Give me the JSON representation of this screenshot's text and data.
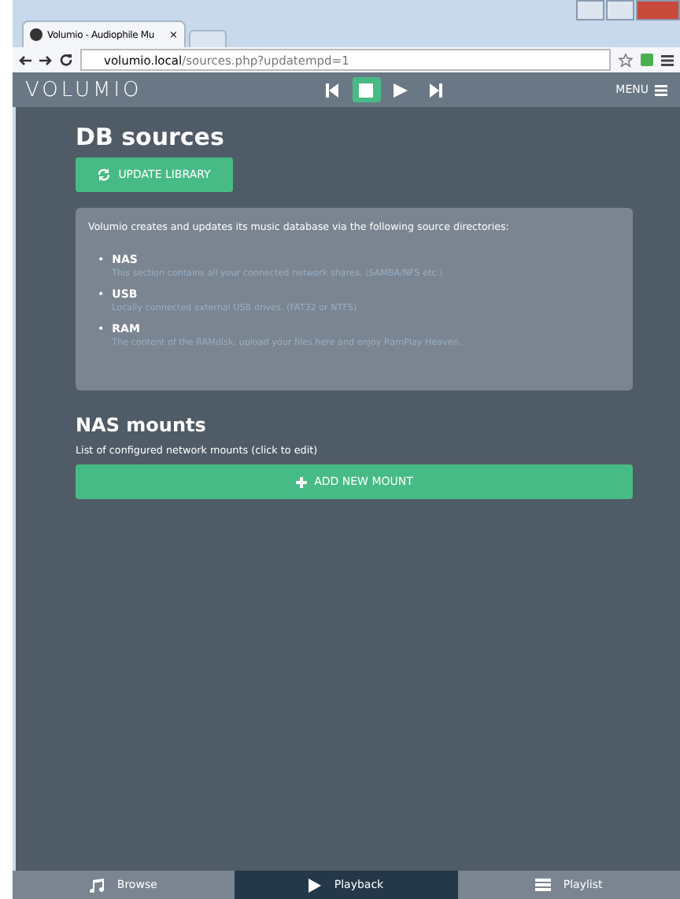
{
  "browser": {
    "tab_title": "Volumio - Audiophile Mu",
    "tab_close": "×",
    "url_host": "volumio.local",
    "url_path": "/sources.php?updatempd=1"
  },
  "header": {
    "logo": "VOLUMIO",
    "transport": [
      {
        "kind": "prev",
        "selected": false
      },
      {
        "kind": "stop",
        "selected": true
      },
      {
        "kind": "play",
        "selected": false
      },
      {
        "kind": "next",
        "selected": false
      }
    ],
    "menu": "MENU"
  },
  "title": "DB sources",
  "update_button": "UPDATE LIBRARY",
  "panel": {
    "bullet": "•",
    "intro": "Volumio creates and updates its music database via the following source directories:",
    "sources": [
      {
        "name": "NAS",
        "description": "This section contains all your connected network shares. (SAMBA/NFS etc.)"
      },
      {
        "name": "USB",
        "description": "Locally connected external USB drives. (FAT32 or NTFS)"
      },
      {
        "name": "RAM",
        "description": "The content of the RAMdisk, upload your files here and enjoy RamPlay Heaven."
      }
    ]
  },
  "nas": {
    "title": "NAS mounts",
    "subtitle": "List of configured network mounts (click to edit)",
    "add_button": "ADD NEW MOUNT"
  },
  "bottom_nav": [
    {
      "kind": "browse",
      "label": "Browse",
      "selected": false
    },
    {
      "kind": "playback",
      "label": "Playback",
      "selected": true
    },
    {
      "kind": "playlist",
      "label": "Playlist",
      "selected": false
    }
  ]
}
